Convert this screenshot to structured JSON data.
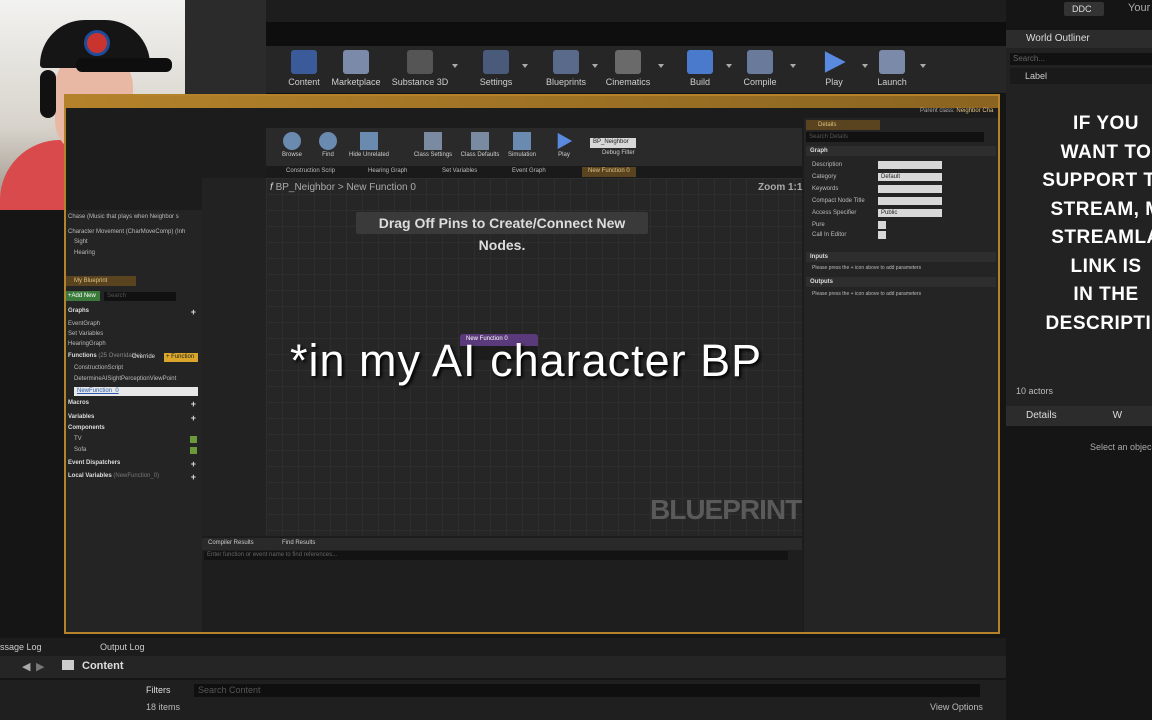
{
  "topbar": {
    "ddc_label": "DDC",
    "user_label": "Your"
  },
  "toolbar": {
    "items": [
      "Content",
      "Marketplace",
      "Substance 3D",
      "Settings",
      "Blueprints",
      "Cinematics",
      "Build",
      "Compile",
      "Play",
      "Launch"
    ]
  },
  "bp": {
    "parent_class": "Parent class:",
    "parent_value": "Neighbor Cha",
    "tools": [
      "Browse",
      "Find",
      "Hide Unrelated",
      "Class Settings",
      "Class Defaults",
      "Simulation",
      "Play",
      "Debug Filter"
    ],
    "debug_value": "BP_Neighbor",
    "tabs": [
      "Construction Scrip",
      "Hearing Graph",
      "Set Variables",
      "Event Graph",
      "New Function 0"
    ],
    "breadcrumb_root": "BP_Neighbor",
    "breadcrumb_sep": ">",
    "breadcrumb_fn": "New Function 0",
    "zoom": "Zoom 1:1",
    "drag_msg": "Drag Off Pins to Create/Connect New Nodes.",
    "node_title": "New Function 0",
    "watermark": "BLUEPRINT",
    "left_tree": [
      "Chase (Music that plays when Neighbor s",
      "Character Movement (CharMoveComp) (Inh",
      "Sight",
      "Hearing"
    ],
    "my_blueprint_tab": "My Blueprint",
    "add_new": "+Add New",
    "search_placeholder": "Search",
    "graphs_header": "Graphs",
    "graphs": [
      "EventGraph",
      "Set Variables",
      "HearingGraph"
    ],
    "functions_header": "Functions",
    "functions_overridable": "(25 Overridable)",
    "override_label": "Override",
    "add_function": "+ Function",
    "functions": [
      "ConstructionScript",
      "DetermineAISightPerceptionViewPoint"
    ],
    "new_function_edit": "NewFunction_0",
    "macros_header": "Macros",
    "variables_header": "Variables",
    "components_header": "Components",
    "components": [
      "TV",
      "Sofa"
    ],
    "dispatchers_header": "Event Dispatchers",
    "local_vars_header": "Local Variables",
    "local_vars_scope": "(NewFunction_0)",
    "results_tabs": [
      "Compiler Results",
      "Find Results"
    ],
    "results_search": "Enter function or event name to find references...",
    "details_tab": "Details",
    "details_search": "Search Details",
    "graph_section": "Graph",
    "props": [
      "Description",
      "Category",
      "Keywords",
      "Compact Node Title",
      "Access Specifier",
      "Pure",
      "Call In Editor"
    ],
    "category_value": "Default",
    "access_value": "Public",
    "inputs_section": "Inputs",
    "inputs_hint": "Please press the + icon above to add parameters",
    "outputs_section": "Outputs",
    "outputs_hint": "Please press the + icon above to add parameters"
  },
  "outliner": {
    "title": "World Outliner",
    "search_placeholder": "Search...",
    "label_col": "Label",
    "actors": "10 actors"
  },
  "support_lines": [
    "IF YOU",
    "WANT TO",
    "SUPPORT TH",
    "STREAM, M",
    "STREAMLA",
    "LINK IS",
    "IN THE",
    "DESCRIPTIO"
  ],
  "rdetails": {
    "title": "Details",
    "tab2": "W",
    "select_msg": "Select an objec"
  },
  "bottom": {
    "message_log": "ssage Log",
    "output_log": "Output Log",
    "content": "Content",
    "filters": "Filters",
    "search_content": "Search Content",
    "items": "18 items",
    "view_options": "View Options"
  },
  "caption": "*in my AI character BP",
  "colors": {
    "accent": "#b4822a",
    "node_header": "#5a3a7a",
    "shirt": "#d84a4c"
  }
}
